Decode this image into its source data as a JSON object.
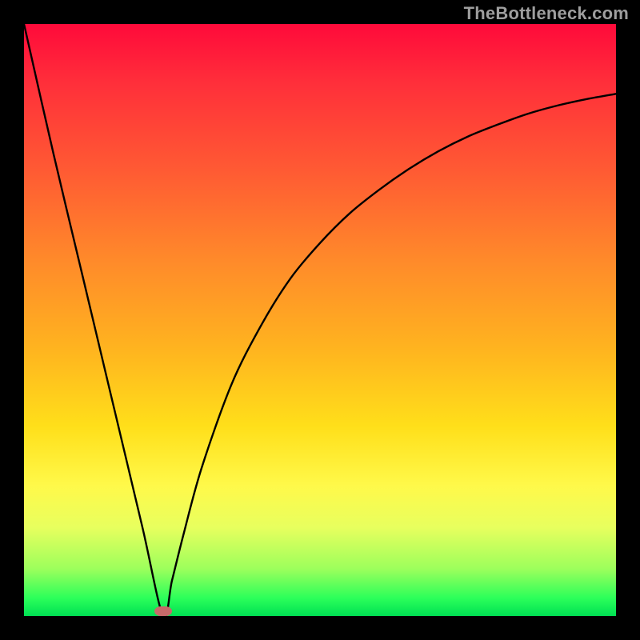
{
  "watermark": "TheBottleneck.com",
  "chart_data": {
    "type": "line",
    "title": "",
    "xlabel": "",
    "ylabel": "",
    "xlim": [
      0,
      100
    ],
    "ylim": [
      0,
      100
    ],
    "grid": false,
    "legend": null,
    "series": [
      {
        "name": "bottleneck-curve",
        "x": [
          0,
          5,
          10,
          15,
          20,
          23.5,
          25,
          27,
          30,
          35,
          40,
          45,
          50,
          55,
          60,
          65,
          70,
          75,
          80,
          85,
          90,
          95,
          100
        ],
        "y": [
          100,
          78,
          57,
          36,
          15,
          0,
          6,
          14,
          25,
          39,
          49,
          57,
          63,
          68,
          72,
          75.5,
          78.5,
          81,
          83,
          84.8,
          86.2,
          87.3,
          88.2
        ]
      }
    ],
    "annotations": [
      {
        "name": "minimum-marker",
        "x": 23.5,
        "y": 0.8
      }
    ],
    "background_gradient": {
      "top": "#ff0a3a",
      "bottom": "#00e053"
    }
  }
}
